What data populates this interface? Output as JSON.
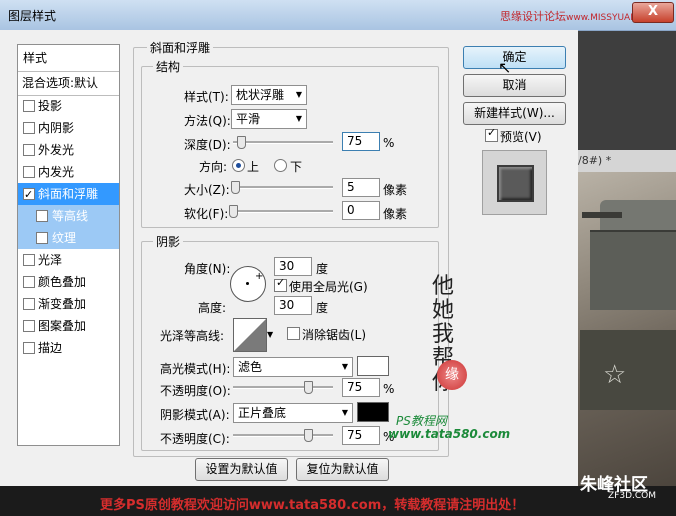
{
  "window": {
    "title": "图层样式",
    "close_glyph": "X",
    "watermark_top": "思缘设计论坛",
    "watermark_top_url": "www.MISSYUAN.com"
  },
  "left_list": {
    "header": "样式",
    "blend_options": "混合选项:默认",
    "items": [
      {
        "label": "投影",
        "checked": false
      },
      {
        "label": "内阴影",
        "checked": false
      },
      {
        "label": "外发光",
        "checked": false
      },
      {
        "label": "内发光",
        "checked": false
      },
      {
        "label": "斜面和浮雕",
        "checked": true
      },
      {
        "label": "等高线",
        "checked": false
      },
      {
        "label": "纹理",
        "checked": false
      },
      {
        "label": "光泽",
        "checked": false
      },
      {
        "label": "颜色叠加",
        "checked": false
      },
      {
        "label": "渐变叠加",
        "checked": false
      },
      {
        "label": "图案叠加",
        "checked": false
      },
      {
        "label": "描边",
        "checked": false
      }
    ]
  },
  "bevel": {
    "group_title": "斜面和浮雕",
    "structure_title": "结构",
    "style_label": "样式(T):",
    "style_value": "枕状浮雕",
    "technique_label": "方法(Q):",
    "technique_value": "平滑",
    "depth_label": "深度(D):",
    "depth_value": "75",
    "depth_unit": "%",
    "direction_label": "方向:",
    "direction_up": "上",
    "direction_down": "下",
    "size_label": "大小(Z):",
    "size_value": "5",
    "size_unit": "像素",
    "soften_label": "软化(F):",
    "soften_value": "0",
    "soften_unit": "像素",
    "depth_slider": 0.08,
    "size_slider": 0.02,
    "soften_slider": 0.0
  },
  "shading": {
    "group_title": "阴影",
    "angle_label": "角度(N):",
    "angle_value": "30",
    "angle_unit": "度",
    "global_light_label": "使用全局光(G)",
    "altitude_label": "高度:",
    "altitude_value": "30",
    "altitude_unit": "度",
    "gloss_contour_label": "光泽等高线:",
    "anti_alias_label": "消除锯齿(L)",
    "highlight_mode_label": "高光模式(H):",
    "highlight_mode_value": "滤色",
    "highlight_color": "#ffffff",
    "highlight_opacity_label": "不透明度(O):",
    "highlight_opacity_value": "75",
    "highlight_opacity_unit": "%",
    "shadow_mode_label": "阴影模式(A):",
    "shadow_mode_value": "正片叠底",
    "shadow_color": "#000000",
    "shadow_opacity_label": "不透明度(C):",
    "shadow_opacity_value": "75",
    "shadow_opacity_unit": "%",
    "highlight_opacity_slider": 0.75,
    "shadow_opacity_slider": 0.75
  },
  "footer_buttons": {
    "set_default": "设置为默认值",
    "reset_default": "复位为默认值"
  },
  "right_buttons": {
    "ok": "确定",
    "cancel": "取消",
    "new_style": "新建样式(W)...",
    "preview_label": "预览(V)"
  },
  "background": {
    "tab_text": "/8#) *",
    "logo_text": "朱峰社区",
    "logo_sub": "ZF3D.COM",
    "bottom_watermark": "更多PS原创教程欢迎访问www.tata580.com，转载教程请注明出处！",
    "calligraphy": "他她我帮你",
    "seal_text": "缘",
    "ps_watermark_1": "PS教程网",
    "ps_watermark_2": "www.tata580.com"
  }
}
